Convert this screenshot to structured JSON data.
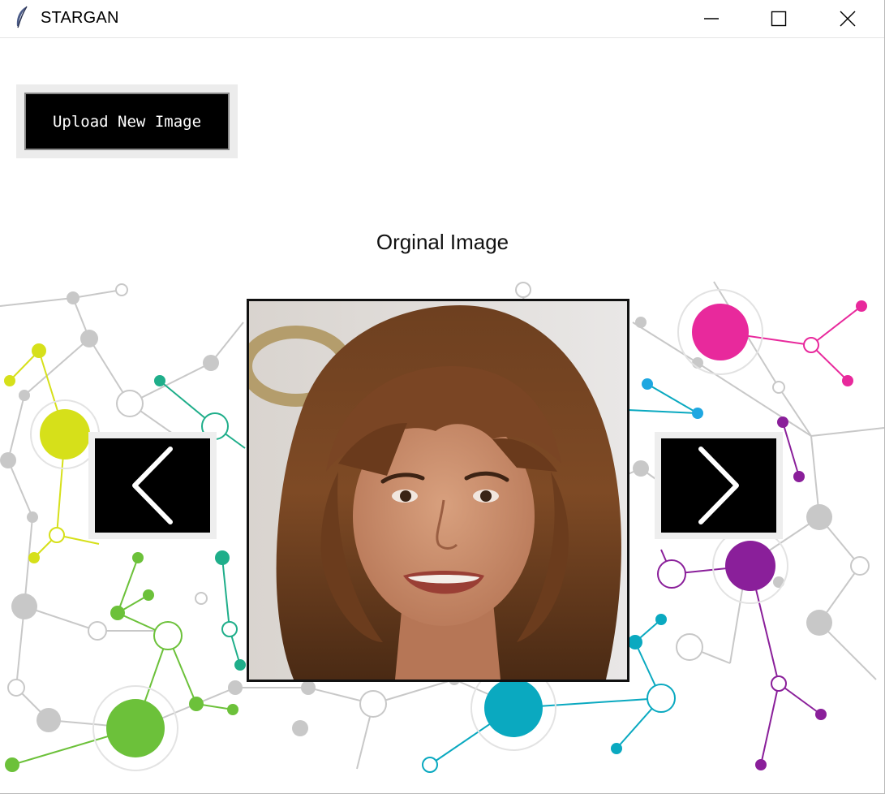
{
  "window": {
    "title": "STARGAN",
    "icon": "feather-icon",
    "controls": [
      "minimize-icon",
      "maximize-icon",
      "close-icon"
    ]
  },
  "toolbar": {
    "upload_label": "Upload New Image"
  },
  "viewer": {
    "caption": "Orginal Image",
    "prev_icon": "chevron-left-icon",
    "next_icon": "chevron-right-icon"
  },
  "colors": {
    "button_bg": "#000000",
    "button_text": "#ffffff",
    "accent_magenta": "#e8299c",
    "accent_lime": "#d6e01a",
    "accent_green": "#6cc13a",
    "accent_teal": "#0aa9c0",
    "accent_purple": "#8a1f9a"
  }
}
